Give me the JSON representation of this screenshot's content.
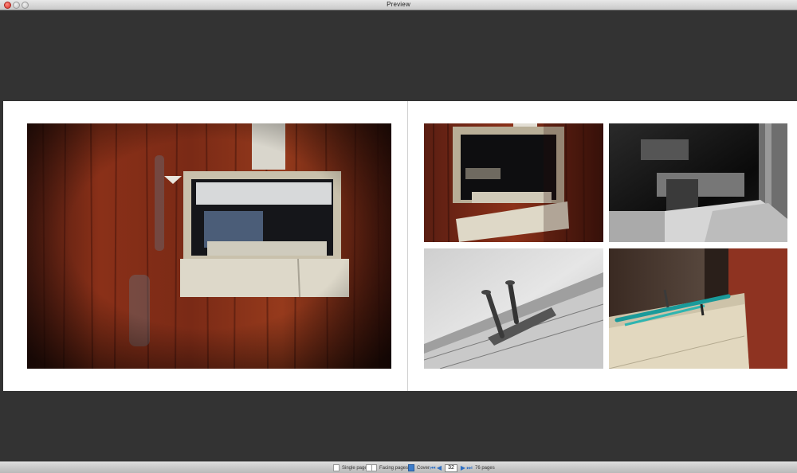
{
  "window": {
    "title": "Preview"
  },
  "statusbar": {
    "single_page_label": "Single page",
    "facing_pages_label": "Facing pages",
    "cover_label": "Cover",
    "current_page": "32",
    "total_pages_label": "76 pages"
  },
  "icons": {
    "single_page": "single-page-icon",
    "facing_pages": "facing-pages-icon",
    "cover": "cover-icon",
    "first": "first-page-icon",
    "prev": "previous-page-icon",
    "next": "next-page-icon",
    "last": "last-page-icon"
  },
  "colors": {
    "rust": "#7a2a18",
    "stage": "#333333",
    "page": "#ffffff",
    "accent": "#2f6fc3"
  }
}
